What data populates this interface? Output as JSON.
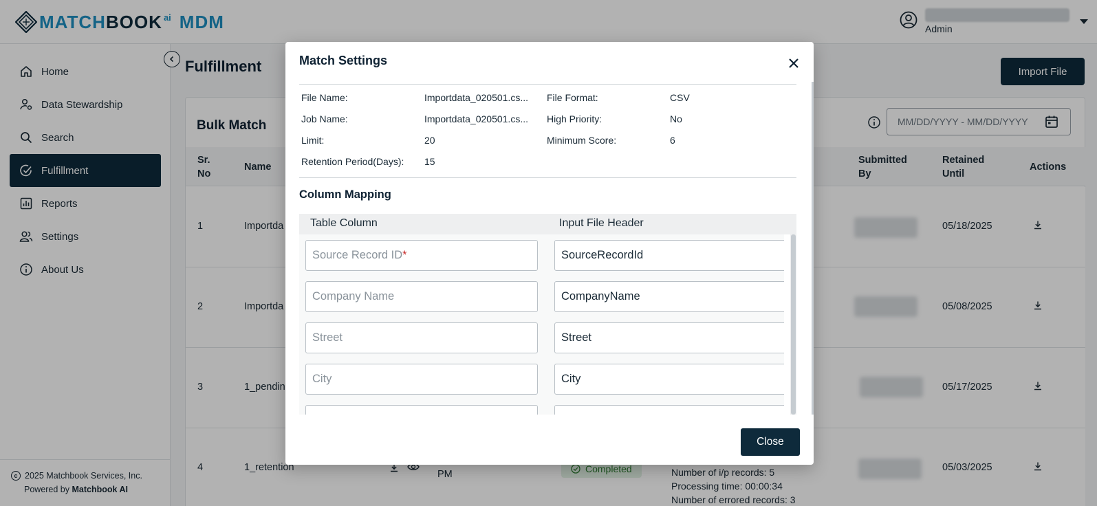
{
  "brand": {
    "part1": "MATCH",
    "part2": "BOOK",
    "sup": "ai",
    "part3": "MDM"
  },
  "user": {
    "role": "Admin"
  },
  "sidebar": {
    "items": [
      {
        "label": "Home",
        "icon": "home-icon"
      },
      {
        "label": "Data Stewardship",
        "icon": "data-stewardship-icon"
      },
      {
        "label": "Search",
        "icon": "search-icon"
      },
      {
        "label": "Fulfillment",
        "icon": "check-circle-icon",
        "active": true
      },
      {
        "label": "Reports",
        "icon": "reports-icon"
      },
      {
        "label": "Settings",
        "icon": "users-icon"
      },
      {
        "label": "About Us",
        "icon": "info-icon"
      }
    ],
    "footer": {
      "copyright": "2025 Matchbook Services, Inc.",
      "powered_prefix": "Powered by",
      "powered_name": "Matchbook AI"
    }
  },
  "page": {
    "title": "Fulfillment",
    "import_label": "Import File",
    "card_title": "Bulk Match",
    "date_placeholder": "MM/DD/YYYY - MM/DD/YYYY"
  },
  "table": {
    "headers": {
      "sr_no_1": "Sr.",
      "sr_no_2": "No",
      "name": "Name",
      "submitted_by_1": "Submitted",
      "submitted_by_2": "By",
      "retained_1": "Retained",
      "retained_2": "Until",
      "actions": "Actions"
    },
    "rows": [
      {
        "sr": "1",
        "name": "Importda",
        "retained": "05/18/2025"
      },
      {
        "sr": "2",
        "name": "Importda",
        "retained": "05/08/2025"
      },
      {
        "sr": "3",
        "name": "1_pendin",
        "retained": "05/17/2025"
      },
      {
        "sr": "4",
        "name": "1_retention",
        "retained": "05/03/2025",
        "time_suffix": "PM",
        "status": "Completed",
        "details": [
          "Number of i/p records: 5",
          "Processing time: 00:00:34",
          "Number of errored records: 3"
        ]
      }
    ]
  },
  "modal": {
    "title": "Match Settings",
    "meta": {
      "file_name_label": "File Name:",
      "file_name_value": "Importdata_020501.cs...",
      "file_format_label": "File Format:",
      "file_format_value": "CSV",
      "job_name_label": "Job Name:",
      "job_name_value": "Importdata_020501.cs...",
      "high_priority_label": "High Priority:",
      "high_priority_value": "No",
      "limit_label": "Limit:",
      "limit_value": "20",
      "min_score_label": "Minimum Score:",
      "min_score_value": "6",
      "retention_label": "Retention Period(Days):",
      "retention_value": "15"
    },
    "section_title": "Column Mapping",
    "col_table": "Table Column",
    "col_input": "Input File Header",
    "mappings": [
      {
        "table": "Source Record ID",
        "required_mark": "*",
        "input": "SourceRecordId"
      },
      {
        "table": "Company Name",
        "input": "CompanyName"
      },
      {
        "table": "Street",
        "input": "Street"
      },
      {
        "table": "City",
        "input": "City"
      },
      {
        "table": "",
        "input": ""
      }
    ],
    "close_label": "Close"
  }
}
